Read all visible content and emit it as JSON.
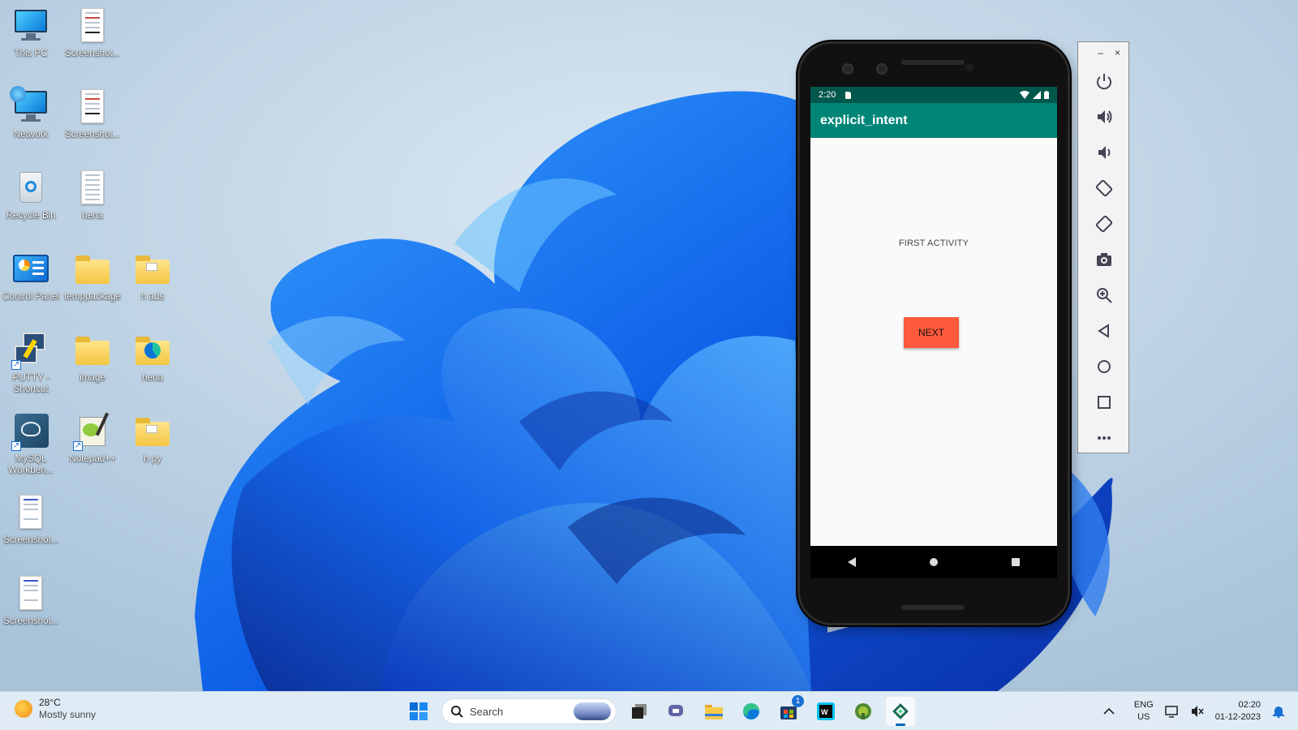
{
  "desktop": {
    "icons": [
      {
        "label": "This PC"
      },
      {
        "label": "Screenshot..."
      },
      {
        "label": "Network"
      },
      {
        "label": "Screenshot..."
      },
      {
        "label": "Recycle Bin"
      },
      {
        "label": "hena"
      },
      {
        "label": "Control Panel"
      },
      {
        "label": "temppackage"
      },
      {
        "label": "h ads"
      },
      {
        "label": "PUTTY - Shortcut"
      },
      {
        "label": "image"
      },
      {
        "label": "hena"
      },
      {
        "label": "MySQL Workben..."
      },
      {
        "label": "Notepad++"
      },
      {
        "label": "h py"
      },
      {
        "label": "Screenshot..."
      },
      {
        "label": "Screenshot..."
      }
    ]
  },
  "emulator": {
    "status_time": "2:20",
    "app_title": "explicit_intent",
    "content_text": "FIRST ACTIVITY",
    "button_label": "NEXT",
    "toolbar": {
      "minimize": "–",
      "close": "×",
      "buttons": [
        "power-icon",
        "volume-up-icon",
        "volume-down-icon",
        "rotate-left-icon",
        "rotate-right-icon",
        "camera-icon",
        "zoom-icon",
        "back-icon",
        "home-icon",
        "overview-icon",
        "more-icon"
      ]
    }
  },
  "taskbar": {
    "weather_temp": "28°C",
    "weather_desc": "Mostly sunny",
    "search_placeholder": "Search",
    "store_badge": "1",
    "lang_top": "ENG",
    "lang_bottom": "US",
    "time": "02:20",
    "date": "01-12-2023"
  },
  "colors": {
    "appbar": "#008577",
    "statusbar": "#00574b",
    "button": "#ff5a3c"
  }
}
